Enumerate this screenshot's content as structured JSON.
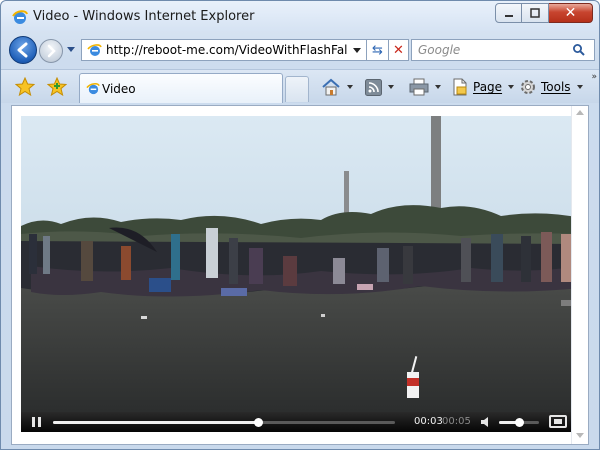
{
  "window": {
    "title": "Video - Windows Internet Explorer",
    "minimize_icon": "minimize-icon",
    "maximize_icon": "maximize-icon",
    "close_icon": "close-icon"
  },
  "navigation": {
    "address": "http://reboot-me.com/VideoWithFlashFallback",
    "search_placeholder": "Google"
  },
  "tabs": [
    {
      "label": "Video",
      "icon": "ie-page-icon"
    }
  ],
  "commands": {
    "page_label": "Page",
    "tools_label": "Tools",
    "items": [
      "home-icon",
      "rss-feed-icon",
      "print-icon",
      "page-icon",
      "tools-gear-icon"
    ]
  },
  "video": {
    "current_time": "00:03",
    "duration": "00:05",
    "progress": 0.6,
    "volume": 0.5,
    "state": "playing"
  },
  "colors": {
    "accent": "#1f5fb8",
    "close_button": "#c8452f",
    "player_bar": "#0b0b0b"
  }
}
